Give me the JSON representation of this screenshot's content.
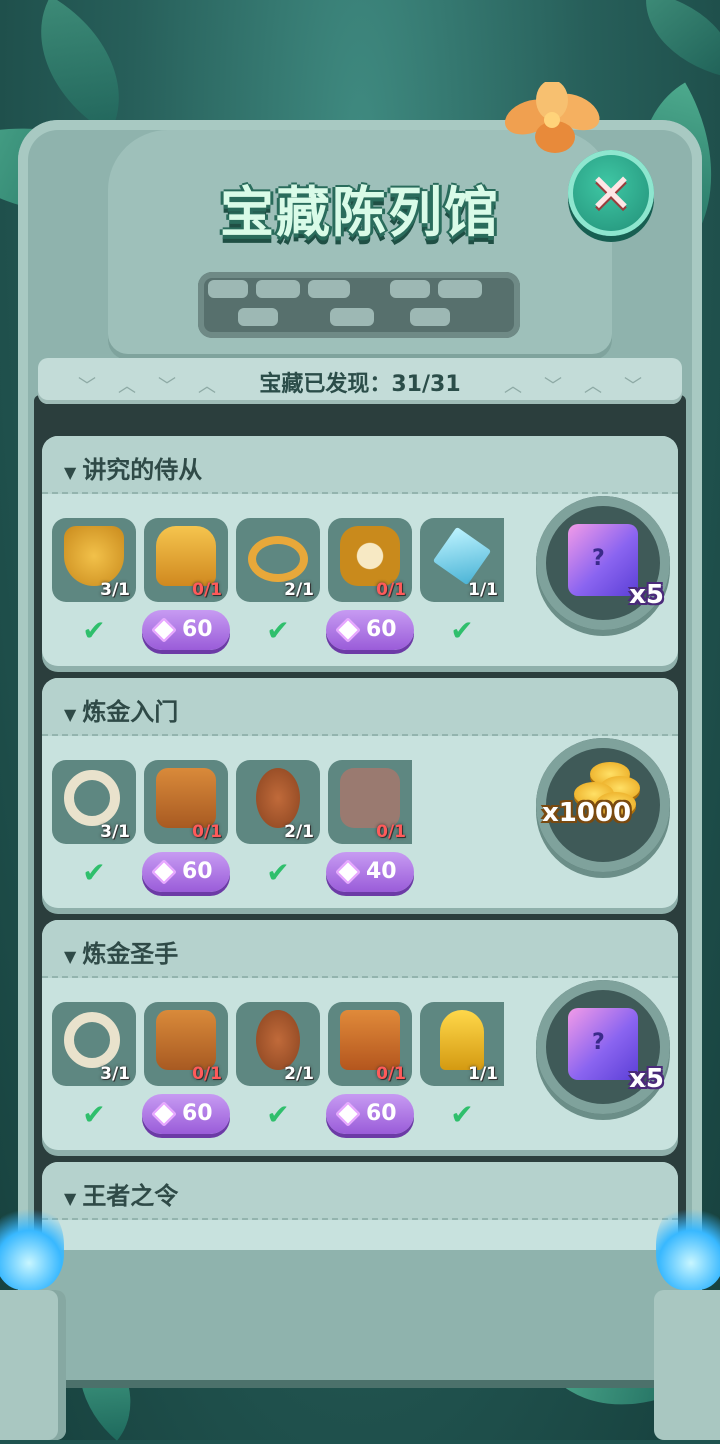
{
  "header": {
    "title": "宝藏陈列馆",
    "close_icon": "close-icon",
    "found_label": "宝藏已发现：",
    "found_count": "31/31"
  },
  "colors": {
    "accent": "#2fbf6c",
    "gem_button": "#9a5cd9",
    "missing_count": "#ff5a5a",
    "panel": "#c8e2de"
  },
  "sets": [
    {
      "title": "讲究的侍从",
      "items": [
        {
          "icon": "mickey-shield-icon",
          "count": "3/1",
          "status": "check"
        },
        {
          "icon": "golden-armor-icon",
          "count": "0/1",
          "status": "buy",
          "price": "60"
        },
        {
          "icon": "golden-belt-icon",
          "count": "2/1",
          "status": "check"
        },
        {
          "icon": "panda-medal-icon",
          "count": "0/1",
          "status": "buy",
          "price": "60"
        },
        {
          "icon": "crystal-sword-icon",
          "count": "1/1",
          "status": "check"
        }
      ],
      "reward": {
        "icon": "mystery-ticket-icon",
        "qty": "x5"
      }
    },
    {
      "title": "炼金入门",
      "items": [
        {
          "icon": "bone-ring-icon",
          "count": "3/1",
          "status": "check"
        },
        {
          "icon": "tiki-mask-icon",
          "count": "0/1",
          "status": "buy",
          "price": "60"
        },
        {
          "icon": "tribal-shield-icon",
          "count": "2/1",
          "status": "check"
        },
        {
          "icon": "stone-tablet-icon",
          "count": "0/1",
          "status": "buy",
          "price": "40"
        }
      ],
      "reward": {
        "icon": "gold-coins-icon",
        "qty": "x1000"
      }
    },
    {
      "title": "炼金圣手",
      "items": [
        {
          "icon": "bone-ring-icon",
          "count": "3/1",
          "status": "check"
        },
        {
          "icon": "tiki-mask-icon",
          "count": "0/1",
          "status": "buy",
          "price": "60"
        },
        {
          "icon": "tribal-shield-icon",
          "count": "2/1",
          "status": "check"
        },
        {
          "icon": "spell-book-icon",
          "count": "0/1",
          "status": "buy",
          "price": "60"
        },
        {
          "icon": "golden-trophy-icon",
          "count": "1/1",
          "status": "check"
        }
      ],
      "reward": {
        "icon": "mystery-ticket-icon",
        "qty": "x5"
      }
    },
    {
      "title": "王者之令"
    }
  ],
  "check_mark": "✔"
}
